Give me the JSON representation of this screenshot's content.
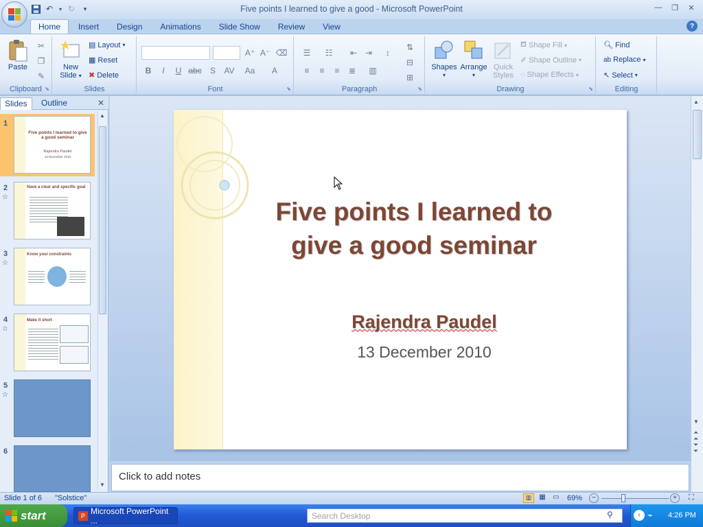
{
  "window": {
    "title": "Five points I learned to give a good - Microsoft PowerPoint"
  },
  "ribbon": {
    "tabs": [
      "Home",
      "Insert",
      "Design",
      "Animations",
      "Slide Show",
      "Review",
      "View"
    ],
    "clipboard": {
      "paste": "Paste",
      "label": "Clipboard"
    },
    "slides": {
      "new_slide": "New",
      "new_slide2": "Slide",
      "layout": "Layout",
      "reset": "Reset",
      "delete": "Delete",
      "label": "Slides"
    },
    "font": {
      "label": "Font"
    },
    "paragraph": {
      "label": "Paragraph"
    },
    "drawing": {
      "shapes": "Shapes",
      "arrange": "Arrange",
      "quick_styles": "Quick",
      "quick_styles2": "Styles",
      "shape_fill": "Shape Fill",
      "shape_outline": "Shape Outline",
      "shape_effects": "Shape Effects",
      "label": "Drawing"
    },
    "editing": {
      "find": "Find",
      "replace": "Replace",
      "select": "Select",
      "label": "Editing"
    }
  },
  "left_panel": {
    "tabs": [
      "Slides",
      "Outline"
    ],
    "thumbnails": [
      {
        "num": "1",
        "title": "Five points I learned to give a good seminar",
        "line1": "Rajendra Paudel",
        "line2": "13 December 2010"
      },
      {
        "num": "2",
        "title": "Have a clear and specific goal"
      },
      {
        "num": "3",
        "title": "Know your constraints"
      },
      {
        "num": "4",
        "title": "Make it short"
      },
      {
        "num": "5"
      },
      {
        "num": "6"
      }
    ]
  },
  "slide": {
    "title_line1": "Five points I learned to",
    "title_line2": "give a good seminar",
    "author": "Rajendra Paudel",
    "date": "13 December 2010"
  },
  "notes": {
    "placeholder": "Click to add notes"
  },
  "status": {
    "slide_of": "Slide 1 of 6",
    "theme": "\"Solstice\"",
    "zoom": "69%"
  },
  "taskbar": {
    "start": "start",
    "task_ppt": "Microsoft PowerPoint ...",
    "search": "Search Desktop",
    "time": "4:26 PM"
  }
}
